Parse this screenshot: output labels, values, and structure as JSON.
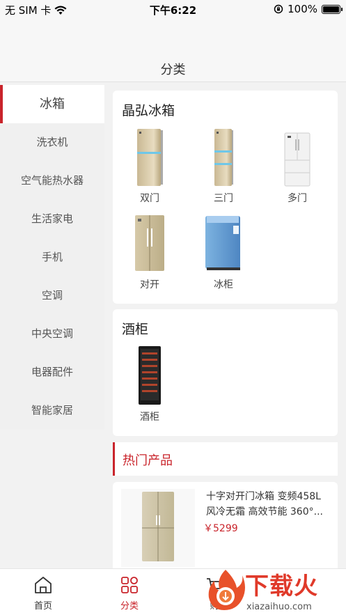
{
  "status_bar": {
    "carrier": "无 SIM 卡",
    "time": "下午6:22",
    "battery_text": "100%",
    "wifi_icon": "wifi-icon",
    "lock_icon": "orientation-lock-icon",
    "battery_level": 1.0
  },
  "nav": {
    "title": "分类"
  },
  "sidebar": {
    "items": [
      {
        "label": "冰箱"
      },
      {
        "label": "洗衣机"
      },
      {
        "label": "空气能热水器"
      },
      {
        "label": "生活家电"
      },
      {
        "label": "手机"
      },
      {
        "label": "空调"
      },
      {
        "label": "中央空调"
      },
      {
        "label": "电器配件"
      },
      {
        "label": "智能家居"
      }
    ]
  },
  "sections": [
    {
      "title": "晶弘冰箱",
      "items": [
        {
          "label": "双门"
        },
        {
          "label": "三门"
        },
        {
          "label": "多门"
        },
        {
          "label": "对开"
        },
        {
          "label": "冰柜"
        }
      ]
    },
    {
      "title": "酒柜",
      "items": [
        {
          "label": "酒柜"
        }
      ]
    }
  ],
  "hot": {
    "title": "热门产品",
    "products": [
      {
        "name": "十字对开门冰箱 变频458L 风冷无霜 高效节能 360°...",
        "price": "￥5299"
      }
    ]
  },
  "tab_bar": {
    "tabs": [
      {
        "label": "首页",
        "icon": "home-icon"
      },
      {
        "label": "分类",
        "icon": "category-icon"
      },
      {
        "label": "购",
        "icon": "cart-icon"
      }
    ]
  },
  "watermark": {
    "cn": "下载火",
    "en": "xiazaihuo.com"
  },
  "colors": {
    "accent": "#c9242b",
    "sidebar_bg": "#f0f0f0"
  }
}
